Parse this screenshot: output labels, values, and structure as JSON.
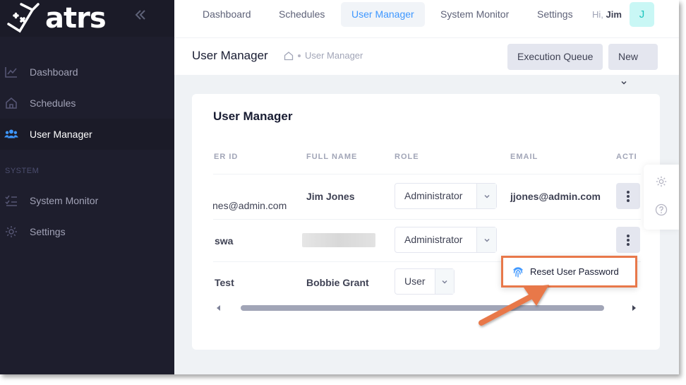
{
  "app": {
    "logo_text": "atrs"
  },
  "sidebar": {
    "items": [
      {
        "label": "Dashboard",
        "icon": "chart-line-icon"
      },
      {
        "label": "Schedules",
        "icon": "home-icon"
      },
      {
        "label": "User Manager",
        "icon": "users-icon"
      }
    ],
    "section_label": "SYSTEM",
    "system_items": [
      {
        "label": "System Monitor",
        "icon": "list-check-icon"
      },
      {
        "label": "Settings",
        "icon": "gear-icon"
      }
    ]
  },
  "topbar": {
    "tabs": [
      "Dashboard",
      "Schedules",
      "User Manager",
      "System Monitor",
      "Settings"
    ],
    "active_tab": "User Manager",
    "greeting_prefix": "Hi,",
    "user_name": "Jim",
    "avatar_initial": "J"
  },
  "toolbar": {
    "title": "User Manager",
    "breadcrumb": "User Manager",
    "execution_queue_label": "Execution Queue",
    "new_label": "New"
  },
  "card": {
    "title": "User Manager",
    "columns": [
      "ER ID",
      "FULL NAME",
      "ROLE",
      "EMAIL",
      "ACTI"
    ],
    "rows": [
      {
        "user_id": "nes@admin.com",
        "full_name": "Jim Jones",
        "role": "Administrator",
        "email": "jjones@admin.com"
      },
      {
        "user_id": "swa",
        "full_name": "",
        "role": "Administrator",
        "email": ""
      },
      {
        "user_id": "Test",
        "full_name": "Bobbie Grant",
        "role": "User",
        "email": ""
      }
    ]
  },
  "menu": {
    "reset_password_label": "Reset User Password"
  },
  "colors": {
    "accent": "#3e97ff",
    "highlight": "#e8784a",
    "sidebar": "#1e1e2d"
  }
}
